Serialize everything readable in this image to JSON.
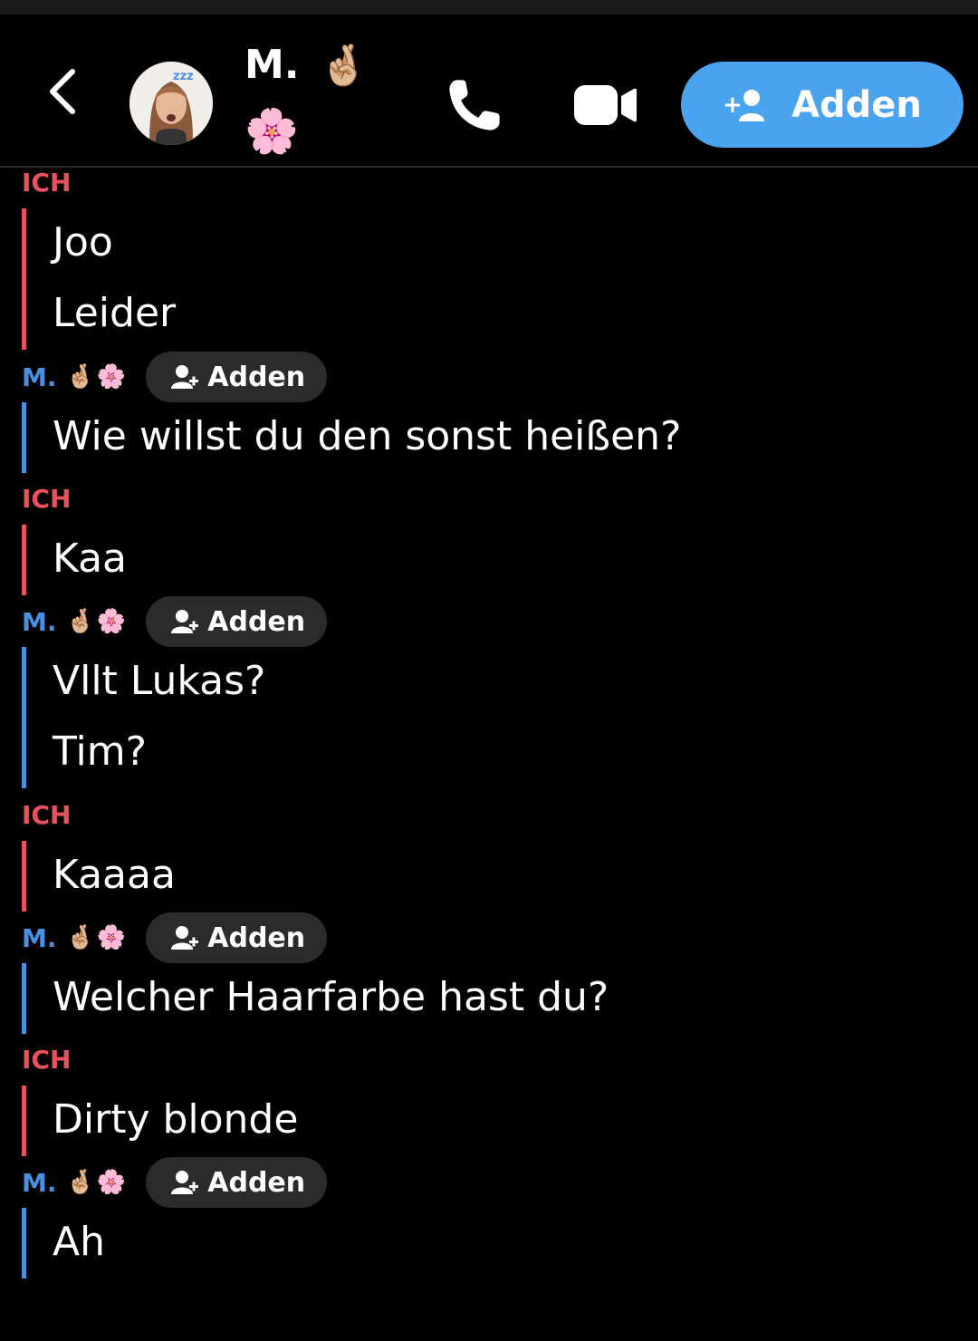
{
  "header": {
    "name": "M.",
    "emoji_line1": "🤞🏼",
    "emoji_line2": "🌸",
    "add_label": "Adden",
    "add_prefix": "+"
  },
  "pill_label": "Adden",
  "contact_name": "M.",
  "contact_emoji": "🤞🏼🌸",
  "me_label": "ICH",
  "blocks": [
    {
      "from": "me",
      "messages": [
        "Joo",
        "Leider"
      ]
    },
    {
      "from": "them",
      "messages": [
        "Wie willst du den sonst heißen?"
      ]
    },
    {
      "from": "me",
      "messages": [
        "Kaa"
      ]
    },
    {
      "from": "them",
      "messages": [
        "Vllt Lukas?",
        "Tim?"
      ]
    },
    {
      "from": "me",
      "messages": [
        "Kaaaa"
      ]
    },
    {
      "from": "them",
      "messages": [
        "Welcher Haarfarbe hast du?"
      ]
    },
    {
      "from": "me",
      "messages": [
        "Dirty blonde"
      ]
    },
    {
      "from": "them",
      "messages": [
        "Ah"
      ]
    }
  ]
}
